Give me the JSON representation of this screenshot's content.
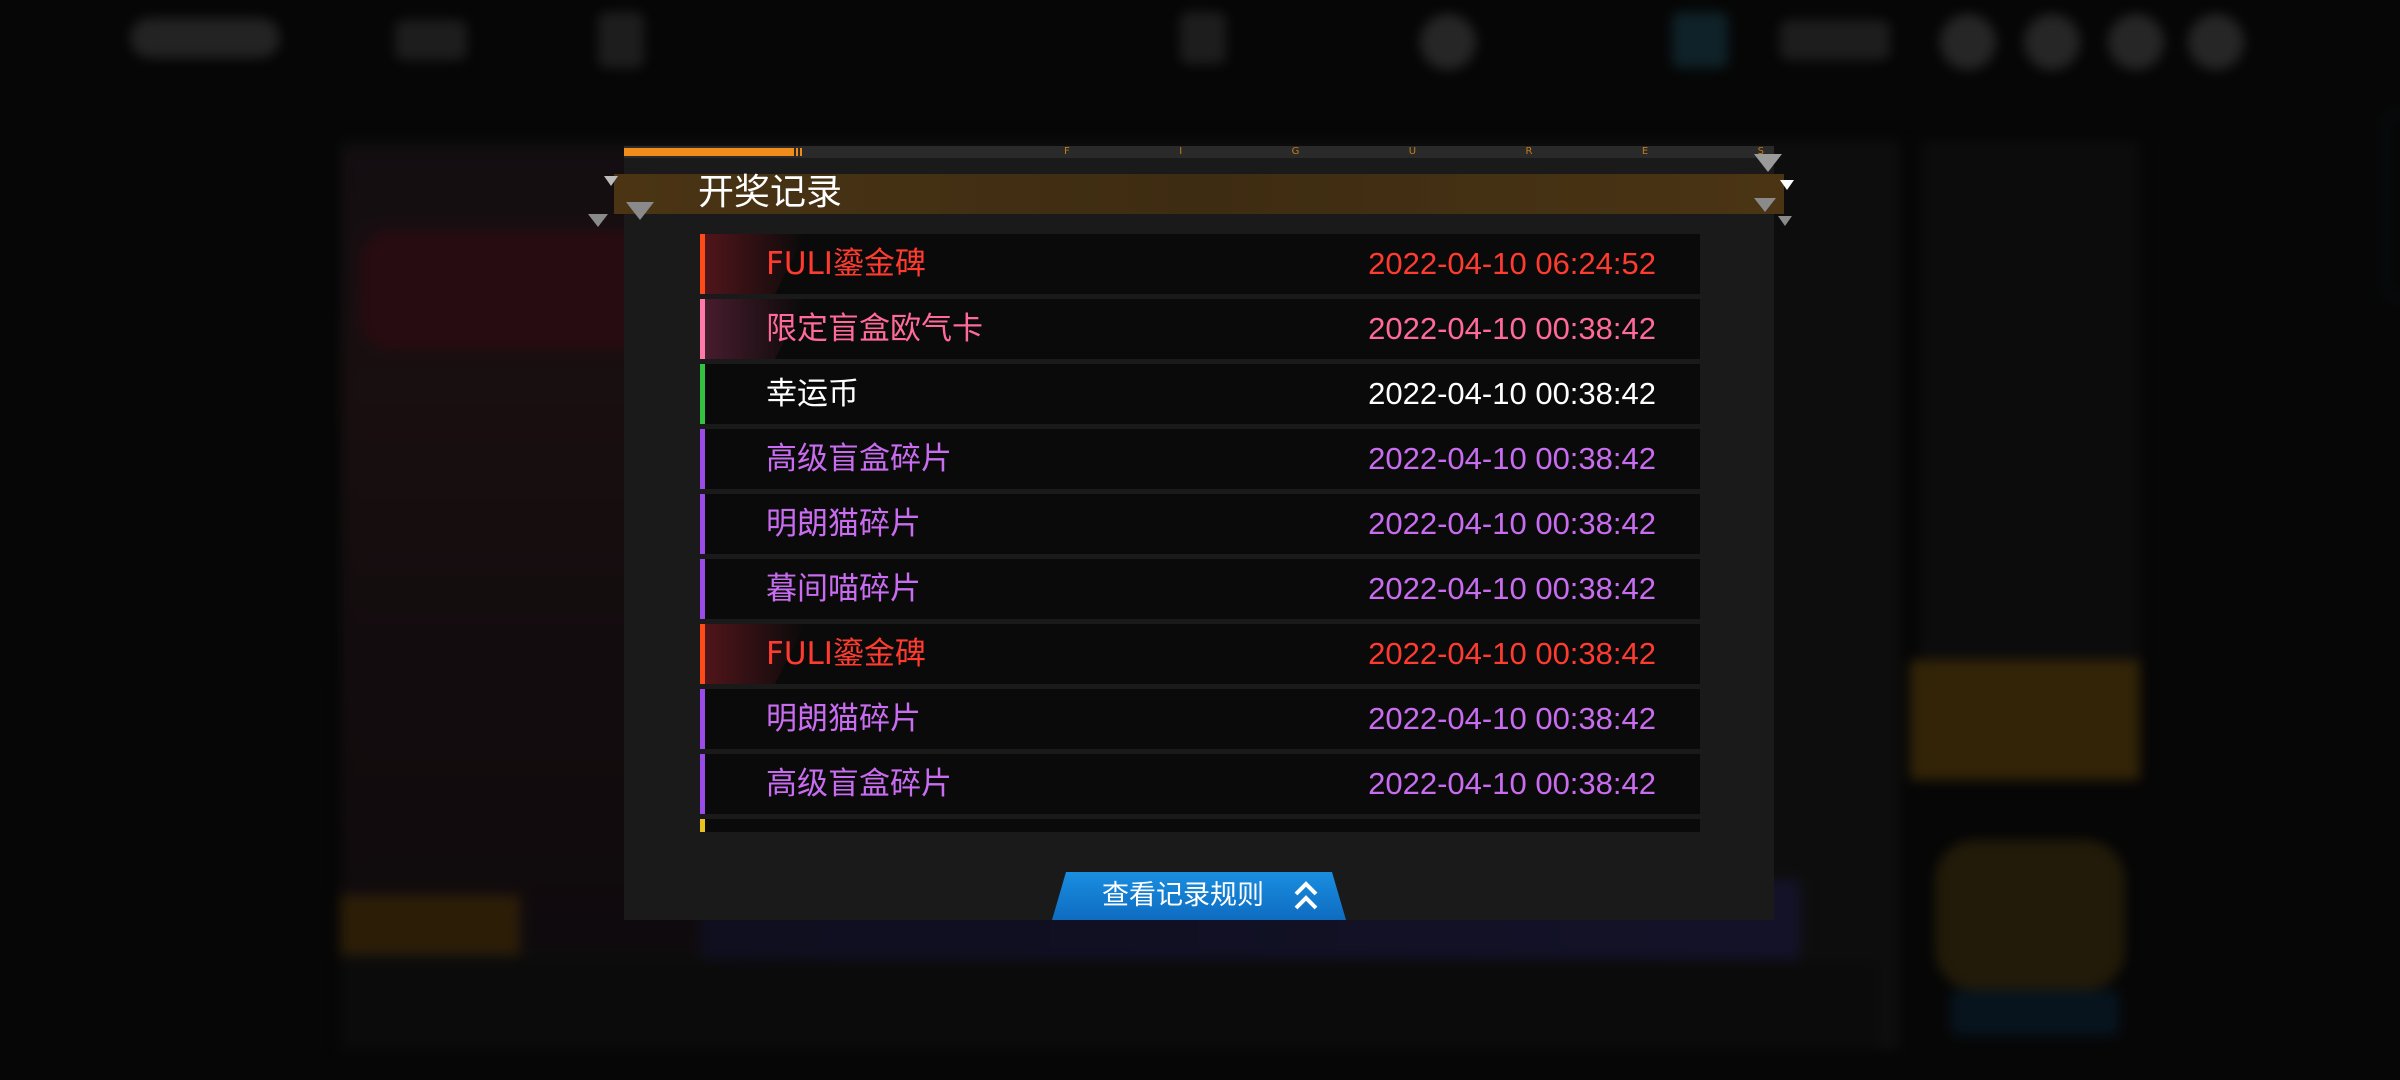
{
  "modal": {
    "title": "开奖记录",
    "header_letters": [
      "F",
      "I",
      "G",
      "U",
      "R",
      "E",
      "S"
    ],
    "rules_button_label": "查看记录规则"
  },
  "colors": {
    "accent_orange": "#f08c1a",
    "header_brown": "#4a3414",
    "button_blue": "#1a8ee0",
    "rarity_red": "#ff3b30",
    "rarity_pink": "#ff6a9a",
    "rarity_white": "#ffffff",
    "rarity_purple": "#c86cf0"
  },
  "records": [
    {
      "name": "FULI鎏金碑",
      "time": "2022-04-10 06:24:52",
      "color": "#ff3b30",
      "accent": "#ff4a1a",
      "glow": "#8a1e28"
    },
    {
      "name": "限定盲盒欧气卡",
      "time": "2022-04-10 00:38:42",
      "color": "#ff6a9a",
      "accent": "#ff7aa8",
      "glow": "#7a2a48"
    },
    {
      "name": "幸运币",
      "time": "2022-04-10 00:38:42",
      "color": "#ffffff",
      "accent": "#34c040",
      "glow": ""
    },
    {
      "name": "高级盲盒碎片",
      "time": "2022-04-10 00:38:42",
      "color": "#c86cf0",
      "accent": "#9a4ae8",
      "glow": ""
    },
    {
      "name": "明朗猫碎片",
      "time": "2022-04-10 00:38:42",
      "color": "#c86cf0",
      "accent": "#9a4ae8",
      "glow": ""
    },
    {
      "name": "暮间喵碎片",
      "time": "2022-04-10 00:38:42",
      "color": "#c86cf0",
      "accent": "#9a4ae8",
      "glow": ""
    },
    {
      "name": "FULI鎏金碑",
      "time": "2022-04-10 00:38:42",
      "color": "#ff3b30",
      "accent": "#ff4a1a",
      "glow": "#8a1e28"
    },
    {
      "name": "明朗猫碎片",
      "time": "2022-04-10 00:38:42",
      "color": "#c86cf0",
      "accent": "#9a4ae8",
      "glow": ""
    },
    {
      "name": "高级盲盒碎片",
      "time": "2022-04-10 00:38:42",
      "color": "#c86cf0",
      "accent": "#9a4ae8",
      "glow": ""
    }
  ],
  "partial_record": {
    "accent": "#e8c020"
  }
}
